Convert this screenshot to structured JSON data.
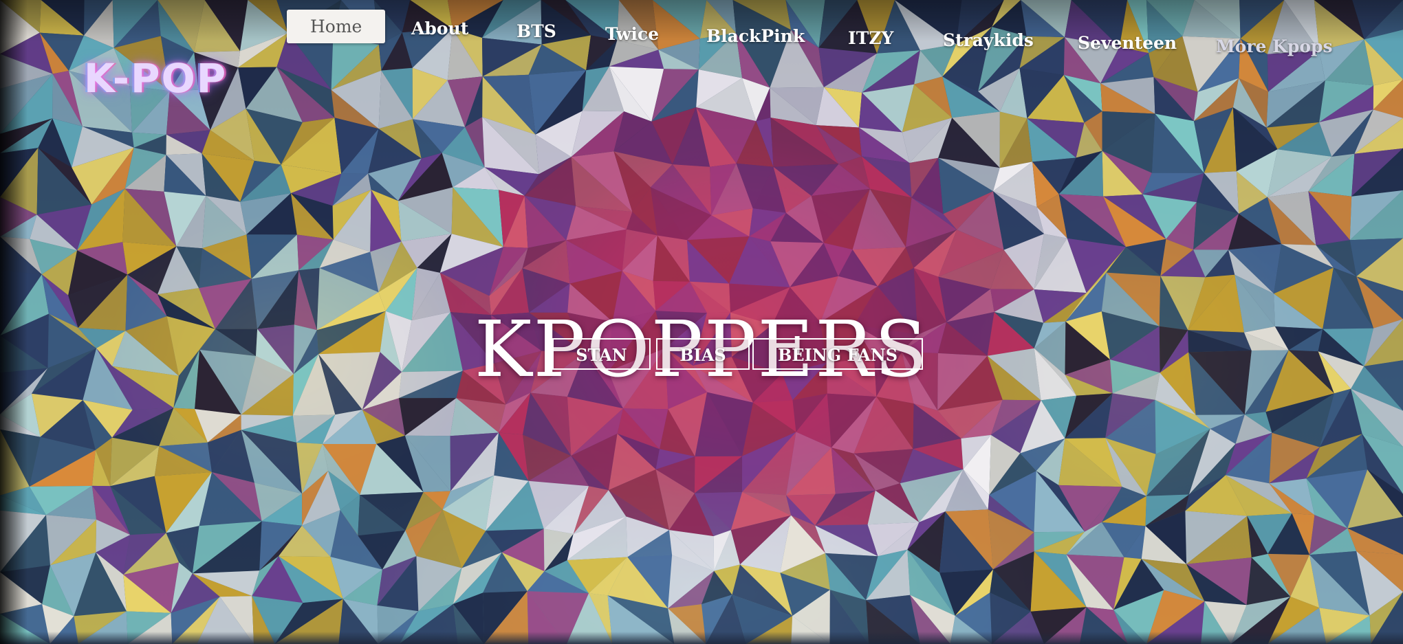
{
  "brand": {
    "logo_text": "K-POP"
  },
  "nav": {
    "items": [
      {
        "label": "Home"
      },
      {
        "label": "About"
      },
      {
        "label": "BTS"
      },
      {
        "label": "Twice"
      },
      {
        "label": "BlackPink"
      },
      {
        "label": "ITZY"
      },
      {
        "label": "Straykids"
      },
      {
        "label": "Seventeen"
      },
      {
        "label": "More Kpops"
      }
    ],
    "active": "Home"
  },
  "hero": {
    "title": "KPOPPERS",
    "buttons": [
      {
        "label": "STAN"
      },
      {
        "label": "BIAS"
      },
      {
        "label": "BEING FANS"
      }
    ]
  },
  "colors": {
    "hero_center": "#b8305e",
    "text": "#ffffff",
    "active_nav_bg": "#f4f2ef"
  }
}
